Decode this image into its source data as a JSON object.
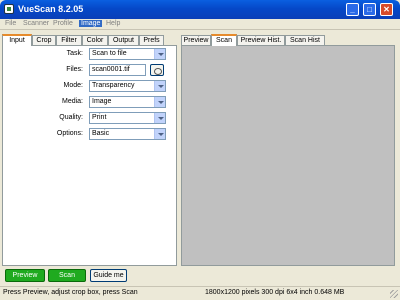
{
  "window": {
    "title": "VueScan 8.2.05",
    "minimize_glyph": "_",
    "maximize_glyph": "□",
    "close_glyph": "✕"
  },
  "menu": [
    "File",
    "Scanner",
    "Profile",
    "Image",
    "Help"
  ],
  "left_tabs": [
    "Input",
    "Crop",
    "Filter",
    "Color",
    "Output",
    "Prefs"
  ],
  "right_tabs": [
    "Preview",
    "Scan",
    "Preview Hist.",
    "Scan Hist"
  ],
  "input": {
    "task_label": "Task:",
    "task_value": "Scan to file",
    "files_label": "Files:",
    "files_value": "scan0001.tif",
    "mode_label": "Mode:",
    "mode_value": "Transparency",
    "media_label": "Media:",
    "media_value": "Image",
    "quality_label": "Quality:",
    "quality_value": "Print",
    "options_label": "Options:",
    "options_value": "Basic"
  },
  "buttons": {
    "preview": "Preview",
    "scan": "Scan",
    "guide": "Guide me"
  },
  "status": {
    "left": "Press Preview, adjust crop box, press Scan",
    "right": "1800x1200 pixels 300 dpi 6x4 inch 0.648 MB"
  },
  "colors": {
    "title_bar": "#0548c8",
    "green_button": "#1faa1f",
    "preview_background": "#c0c0c0",
    "tab_highlight": "#e68b2c"
  }
}
